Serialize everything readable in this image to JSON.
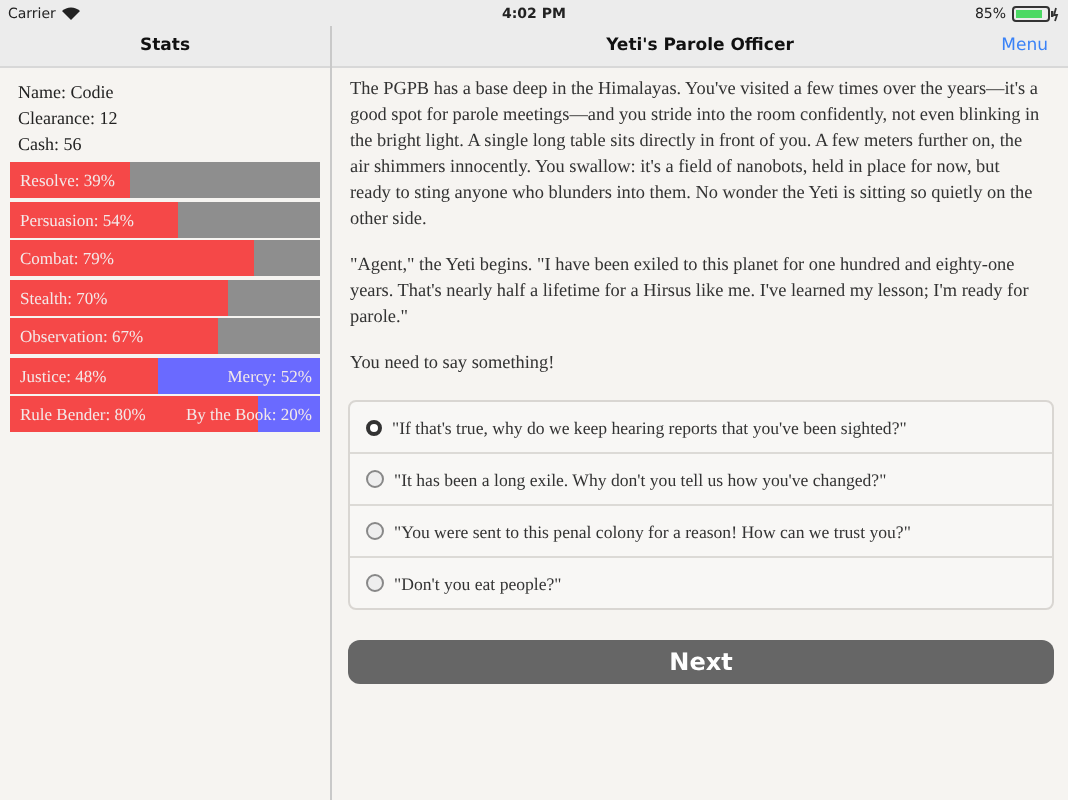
{
  "status_bar": {
    "carrier": "Carrier",
    "time": "4:02 PM",
    "battery": "85%"
  },
  "sidebar": {
    "title": "Stats",
    "info": [
      "Name: Codie",
      "Clearance: 12",
      "Cash: 56"
    ],
    "stats": [
      {
        "kind": "single",
        "label": "Resolve: 39%",
        "level": 0.39
      },
      {
        "kind": "single",
        "label": "Persuasion: 54%",
        "level": 0.54
      },
      {
        "kind": "single",
        "label": "Combat: 79%",
        "level": 0.79
      },
      {
        "kind": "single",
        "label": "Stealth: 70%",
        "level": 0.7
      },
      {
        "kind": "single",
        "label": "Observation: 67%",
        "level": 0.67
      },
      {
        "kind": "opposed",
        "label": "Justice: 48%",
        "right_label": "Mercy: 52%",
        "level": 0.48
      },
      {
        "kind": "opposed",
        "label": "Rule Bender: 80%",
        "right_label": "By the Book: 20%",
        "level": 0.8
      }
    ]
  },
  "main": {
    "title": "Yeti's Parole Officer",
    "menu": "Menu",
    "paragraphs": [
      "The PGPB has a base deep in the Himalayas. You've visited a few times over the years—it's a good spot for parole meetings—and you stride into the room confidently, not even blinking in the bright light. A single long table sits directly in front of you. A few meters further on, the air shimmers innocently. You swallow: it's a field of nanobots, held in place for now, but ready to sting anyone who blunders into them. No wonder the Yeti is sitting so quietly on the other side.",
      "\"Agent,\" the Yeti begins. \"I have been exiled to this planet for one hundred and eighty-one years. That's nearly half a lifetime for a Hirsus like me. I've learned my lesson; I'm ready for parole.\"",
      "You need to say something!"
    ],
    "choices": [
      {
        "label": "\"If that's true, why do we keep hearing reports that you've been sighted?\"",
        "selected": true
      },
      {
        "label": "\"It has been a long exile. Why don't you tell us how you've changed?\"",
        "selected": false
      },
      {
        "label": "\"You were sent to this penal colony for a reason! How can we trust you?\"",
        "selected": false
      },
      {
        "label": "\"Don't you eat people?\"",
        "selected": false
      }
    ],
    "next_button": "Next"
  }
}
